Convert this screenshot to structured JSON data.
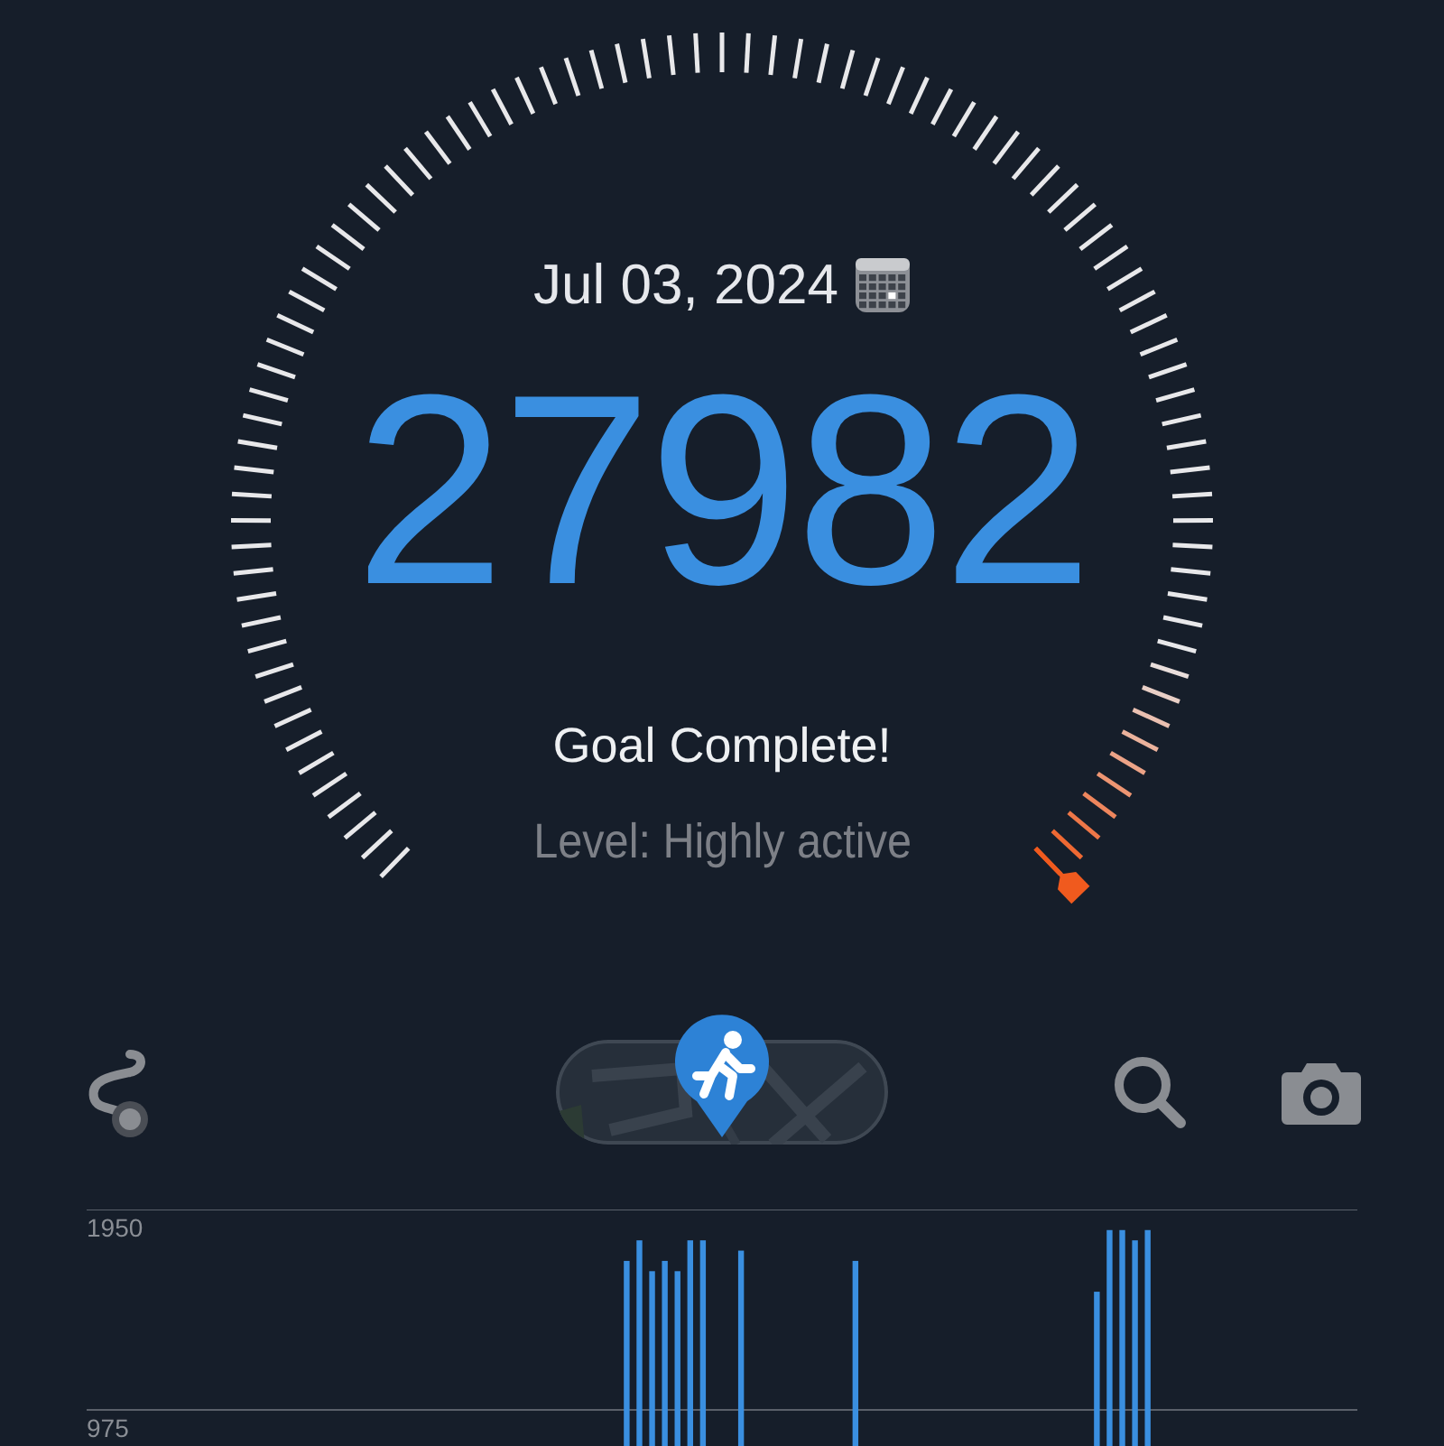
{
  "gauge": {
    "date": "Jul 03, 2024",
    "steps": "27982",
    "status": "Goal Complete!",
    "activity_level": "Level: Highly active"
  },
  "chart": {
    "chart_data": {
      "type": "bar",
      "yticks": [
        975,
        1950
      ],
      "ylim": [
        0,
        1950
      ],
      "values": [
        null,
        null,
        null,
        null,
        null,
        null,
        null,
        null,
        null,
        null,
        null,
        null,
        null,
        null,
        null,
        null,
        null,
        null,
        null,
        null,
        null,
        null,
        null,
        null,
        null,
        null,
        null,
        null,
        null,
        null,
        null,
        null,
        null,
        null,
        null,
        null,
        null,
        null,
        null,
        null,
        null,
        null,
        1700,
        1800,
        1650,
        1700,
        1650,
        1800,
        1800,
        null,
        null,
        1750,
        null,
        null,
        null,
        null,
        null,
        null,
        null,
        null,
        1700,
        null,
        null,
        null,
        null,
        null,
        null,
        null,
        null,
        null,
        null,
        null,
        null,
        null,
        null,
        null,
        null,
        null,
        null,
        1550,
        1850,
        1850,
        1800,
        1850,
        null,
        null,
        null,
        null,
        null,
        null,
        null,
        null,
        null,
        null,
        null,
        null,
        null,
        null,
        null,
        null
      ]
    }
  }
}
